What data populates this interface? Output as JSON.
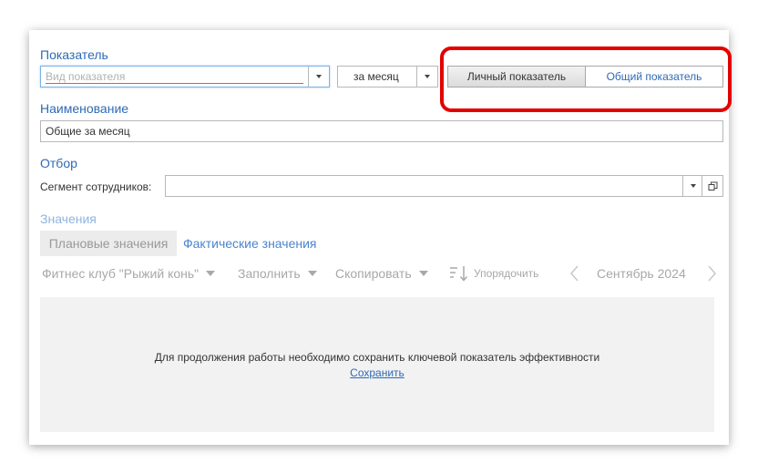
{
  "indicator": {
    "section_label": "Показатель",
    "type_placeholder": "Вид показателя",
    "period_value": "за месяц",
    "toggle": {
      "personal_label": "Личный показатель",
      "general_label": "Общий показатель",
      "selected": "personal"
    }
  },
  "name": {
    "section_label": "Наименование",
    "value": "Общие за месяц"
  },
  "filter": {
    "section_label": "Отбор",
    "segment_label": "Сегмент сотрудников:",
    "segment_value": ""
  },
  "values": {
    "section_label": "Значения",
    "tabs": [
      {
        "label": "Плановые значения",
        "active": true
      },
      {
        "label": "Фактические значения",
        "active": false
      }
    ],
    "toolbar": {
      "club_label": "Фитнес клуб \"Рыжий конь\"",
      "fill_label": "Заполнить",
      "copy_label": "Скопировать",
      "sort_label": "Упорядочить",
      "period_label": "Сентябрь 2024"
    },
    "message": "Для продолжения работы необходимо сохранить ключевой показатель эффективности",
    "save_link": "Сохранить"
  },
  "colors": {
    "accent": "#2e6ab5",
    "highlight": "#e30000",
    "disabled": "#a8a8a8"
  }
}
